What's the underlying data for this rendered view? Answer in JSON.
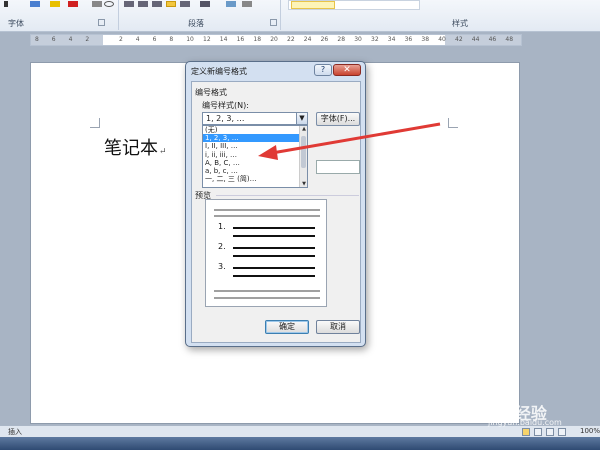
{
  "ribbon": {
    "groups": [
      "字体",
      "段落",
      "样式"
    ]
  },
  "ruler": {
    "ticks": [
      "8",
      "6",
      "4",
      "2",
      "",
      "2",
      "4",
      "6",
      "8",
      "10",
      "12",
      "14",
      "16",
      "18",
      "20",
      "22",
      "24",
      "26",
      "28",
      "30",
      "32",
      "34",
      "36",
      "38",
      "40",
      "42",
      "44",
      "46",
      "48"
    ]
  },
  "document": {
    "text": "笔记本",
    "paragraph_mark": "↵"
  },
  "dialog": {
    "title": "定义新编号格式",
    "help_label": "?",
    "close_label": "✕",
    "section_label": "编号格式",
    "style_label": "编号样式(N):",
    "combo_value": "1, 2, 3, …",
    "font_button": "字体(F)...",
    "options": [
      "(无)",
      "1, 2, 3, …",
      "I, II, III, …",
      "i, ii, iii, …",
      "A, B, C, …",
      "a, b, c, …",
      "一, 二, 三 (简)…"
    ],
    "selected_index": 1,
    "preview_label": "预览",
    "preview_numbers": [
      "1.",
      "2.",
      "3."
    ],
    "ok": "确定",
    "cancel": "取消"
  },
  "statusbar": {
    "mode": "插入",
    "zoom": "100%"
  },
  "watermark": {
    "brand": "Baidu 经验",
    "url": "jingyan.baidu.com"
  },
  "colors": {
    "accent_arrow": "#e03a35",
    "selection": "#3399ff"
  }
}
